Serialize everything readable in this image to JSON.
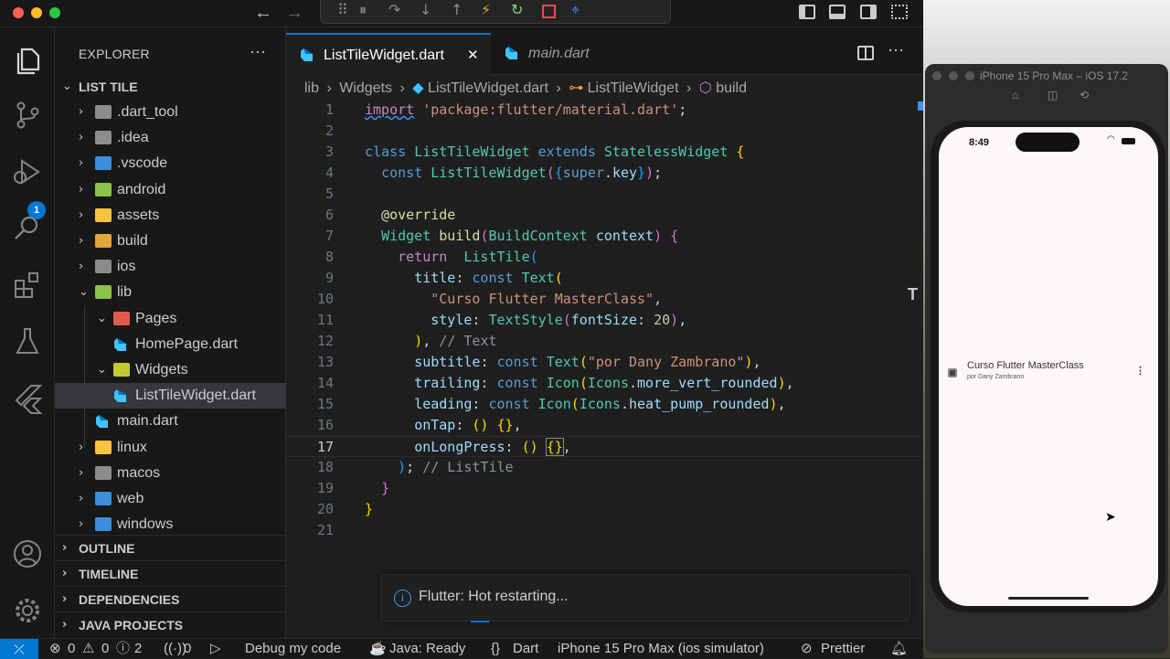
{
  "titlebar": {
    "debug_controls": [
      "grip",
      "pause",
      "step-over",
      "step-into",
      "step-out",
      "hot-reload",
      "restart",
      "stop",
      "inspect"
    ]
  },
  "explorer": {
    "title": "EXPLORER",
    "more": "···",
    "project": "LIST TILE",
    "items": [
      {
        "label": ".dart_tool",
        "type": "folder",
        "color": "#8c8c8c"
      },
      {
        "label": ".idea",
        "type": "folder",
        "color": "#8c8c8c"
      },
      {
        "label": ".vscode",
        "type": "folder",
        "color": "#3c8ddb"
      },
      {
        "label": "android",
        "type": "folder",
        "color": "#8bc34a"
      },
      {
        "label": "assets",
        "type": "folder",
        "color": "#f9c342"
      },
      {
        "label": "build",
        "type": "folder",
        "color": "#e2a53a"
      },
      {
        "label": "ios",
        "type": "folder",
        "color": "#8c8c8c"
      },
      {
        "label": "lib",
        "type": "folder-open",
        "color": "#8bc34a"
      },
      {
        "label": "Pages",
        "type": "folder-open",
        "color": "#e35b4f"
      },
      {
        "label": "HomePage.dart",
        "type": "dart"
      },
      {
        "label": "Widgets",
        "type": "folder-open",
        "color": "#c0ca33"
      },
      {
        "label": "ListTileWidget.dart",
        "type": "dart"
      },
      {
        "label": "main.dart",
        "type": "dart"
      },
      {
        "label": "linux",
        "type": "folder",
        "color": "#f9c342"
      },
      {
        "label": "macos",
        "type": "folder",
        "color": "#8c8c8c"
      },
      {
        "label": "web",
        "type": "folder",
        "color": "#3c8ddb"
      },
      {
        "label": "windows",
        "type": "folder",
        "color": "#3c8ddb"
      }
    ],
    "sections": [
      "OUTLINE",
      "TIMELINE",
      "DEPENDENCIES",
      "JAVA PROJECTS"
    ]
  },
  "activity": {
    "debug_badge": "1"
  },
  "tabs": [
    {
      "label": "ListTileWidget.dart",
      "active": true,
      "close": "✕"
    },
    {
      "label": "main.dart",
      "active": false
    }
  ],
  "breadcrumb": {
    "parts": [
      "lib",
      "Widgets",
      "ListTileWidget.dart",
      "ListTileWidget",
      "build"
    ],
    "sep": "›"
  },
  "code": {
    "line_numbers": [
      "1",
      "2",
      "3",
      "4",
      "5",
      "6",
      "7",
      "8",
      "9",
      "10",
      "11",
      "12",
      "13",
      "14",
      "15",
      "16",
      "17",
      "18",
      "19",
      "20",
      "21"
    ],
    "current_line": "17"
  },
  "notification": {
    "text": "Flutter: Hot restarting..."
  },
  "simulator": {
    "title": "iPhone 15 Pro Max – iOS 17.2",
    "time": "8:49",
    "tile_title": "Curso Flutter MasterClass",
    "tile_subtitle": "por Dany Zambrano"
  },
  "statusbar": {
    "remote": "⤫",
    "errors": "0",
    "warnings": "0",
    "infos": "2",
    "ports": "0",
    "debug": "Debug my code",
    "java": "Java: Ready",
    "language": "Dart",
    "device": "iPhone 15 Pro Max (ios simulator)",
    "prettier": "Prettier"
  },
  "colors": {
    "accent": "#0078d4",
    "background": "#1f1f1f",
    "sidebar": "#181818"
  }
}
